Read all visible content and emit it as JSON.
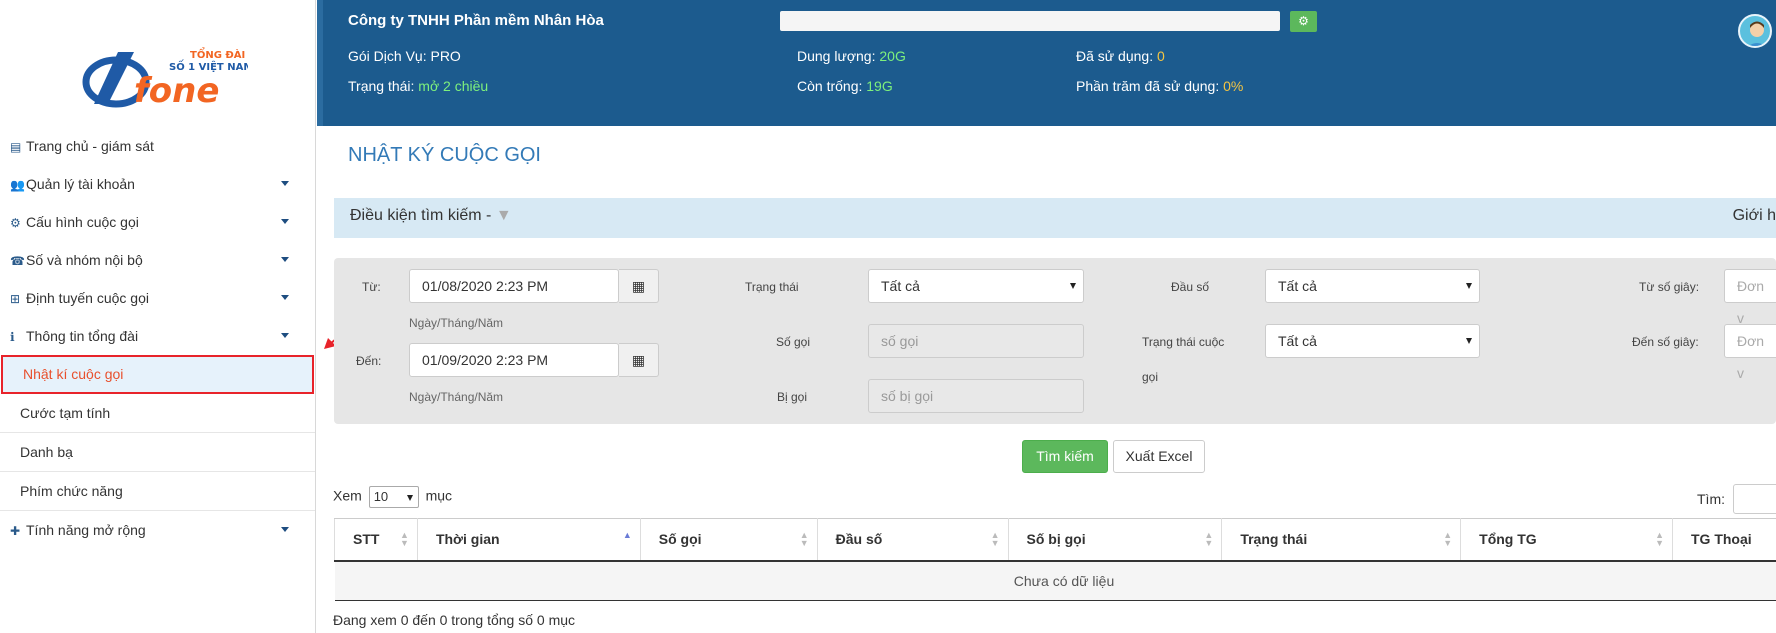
{
  "sidebar": {
    "logo": {
      "top": "TỔNG ĐÀI",
      "line2": "SỐ 1 VIỆT NAM",
      "brand": "fone"
    },
    "items": [
      {
        "label": "Trang chủ - giám sát",
        "icon": "clipboard-icon",
        "caret": false
      },
      {
        "label": "Quản lý tài khoản",
        "icon": "users-icon",
        "caret": true
      },
      {
        "label": "Cấu hình cuộc gọi",
        "icon": "gears-icon",
        "caret": true
      },
      {
        "label": "Số và nhóm nội bộ",
        "icon": "headset-icon",
        "caret": true
      },
      {
        "label": "Định tuyến cuộc gọi",
        "icon": "sitemap-icon",
        "caret": true
      },
      {
        "label": "Thông tin tổng đài",
        "icon": "info-icon",
        "caret": true
      }
    ],
    "subitems": [
      {
        "label": "Nhật kí cuộc gọi",
        "active": true
      },
      {
        "label": "Cước tạm tính",
        "active": false
      },
      {
        "label": "Danh bạ",
        "active": false
      },
      {
        "label": "Phím chức năng",
        "active": false
      }
    ],
    "last_item": {
      "label": "Tính năng mở rộng",
      "icon": "puzzle-icon"
    }
  },
  "header": {
    "company": "Công ty TNHH Phần mềm Nhân Hòa",
    "service_label": "Gói Dịch Vụ:",
    "service_value": "PRO",
    "status_label": "Trạng thái:",
    "status_value": "mở 2 chiều",
    "capacity_label": "Dung lượng:",
    "capacity_value": "20G",
    "free_label": "Còn trống:",
    "free_value": "19G",
    "used_label": "Đã sử dụng:",
    "used_value": "0",
    "percent_label": "Phần trăm đã sử dụng:",
    "percent_value": "0%"
  },
  "page": {
    "title": "NHẬT KÝ CUỘC GỌI",
    "search_bar_title": "Điều kiện tìm kiếm -",
    "search_bar_right": "Giới h"
  },
  "filters": {
    "from_label": "Từ:",
    "from_value": "01/08/2020 2:23 PM",
    "from_hint": "Ngày/Tháng/Năm",
    "to_label": "Đến:",
    "to_value": "01/09/2020 2:23 PM",
    "to_hint": "Ngày/Tháng/Năm",
    "status_label": "Trạng thái",
    "status_value": "Tất cả",
    "caller_label": "Số gọi",
    "caller_placeholder": "số gọi",
    "callee_label": "Bị gọi",
    "callee_placeholder": "số bị gọi",
    "prefix_label": "Đầu số",
    "prefix_value": "Tất cả",
    "call_status_label_1": "Trạng thái cuộc",
    "call_status_label_2": "gọi",
    "call_status_value": "Tất cả",
    "from_sec_label": "Từ số giây:",
    "from_sec_placeholder": "Đơn v",
    "to_sec_label": "Đến số giây:",
    "to_sec_placeholder": "Đơn v"
  },
  "actions": {
    "search": "Tìm kiếm",
    "export": "Xuất Excel"
  },
  "table_controls": {
    "show_label": "Xem",
    "show_value": "10",
    "entries_label": "mục",
    "find_label": "Tìm:"
  },
  "table": {
    "columns": [
      "STT",
      "Thời gian",
      "Số gọi",
      "Đầu số",
      "Số bị gọi",
      "Trạng thái",
      "Tổng TG",
      "TG Thoại"
    ],
    "empty": "Chưa có dữ liệu",
    "info": "Đang xem 0 đến 0 trong tổng số 0 mục"
  }
}
